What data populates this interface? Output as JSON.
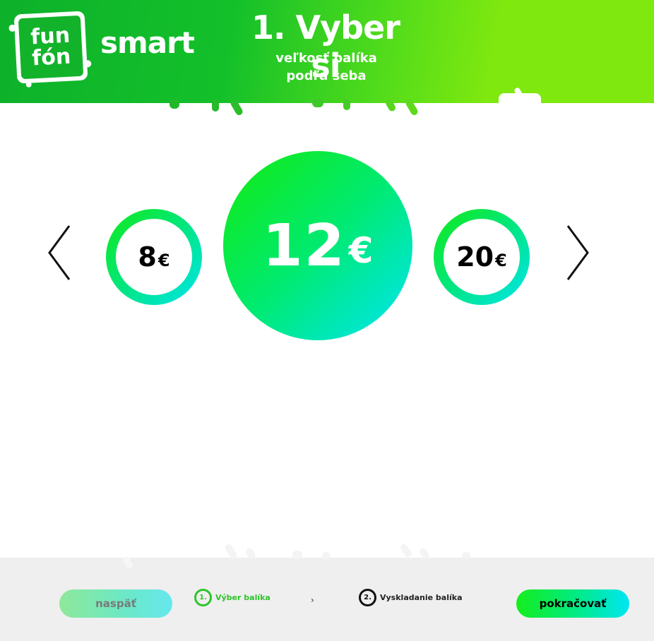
{
  "header": {
    "logo_line1": "fun",
    "logo_line2": "fón",
    "brand": "smart",
    "title": "1. Vyber si",
    "subtitle_line1": "veľkosť balíka",
    "subtitle_line2": "podľa seba"
  },
  "carousel": {
    "prev_icon": "chevron-left-icon",
    "next_icon": "chevron-right-icon",
    "left": {
      "amount": "8",
      "currency": "€"
    },
    "center": {
      "amount": "12",
      "currency": "€"
    },
    "right": {
      "amount": "20",
      "currency": "€"
    }
  },
  "footer": {
    "back_label": "naspäť",
    "next_label": "pokračovať",
    "steps": [
      {
        "number": "1.",
        "label": "Výber balíka"
      },
      {
        "number": "2.",
        "label": "Vyskladanie balíka"
      }
    ],
    "step_separator": "›"
  },
  "colors": {
    "brand_green": "#12b32a",
    "accent_lime": "#7fe80f",
    "accent_cyan": "#00e4f0",
    "active_step": "#2fc42a"
  }
}
